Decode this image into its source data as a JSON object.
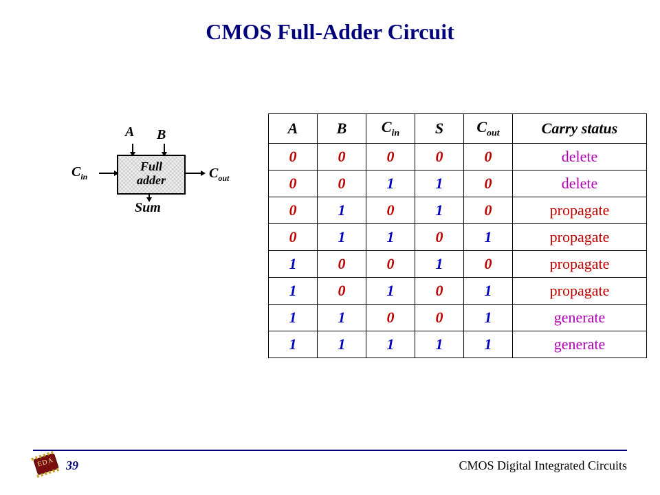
{
  "title": "CMOS Full-Adder Circuit",
  "diagram": {
    "box_label1": "Full",
    "box_label2": "adder",
    "labels": {
      "A": "A",
      "B": "B",
      "Cin": "C",
      "Cin_sub": "in",
      "Cout": "C",
      "Cout_sub": "out",
      "Sum": "Sum"
    }
  },
  "table": {
    "headers": [
      "A",
      "B",
      "C_in",
      "S",
      "C_out",
      "Carry status"
    ],
    "rows": [
      {
        "v": [
          "0",
          "0",
          "0",
          "0",
          "0"
        ],
        "status": "delete"
      },
      {
        "v": [
          "0",
          "0",
          "1",
          "1",
          "0"
        ],
        "status": "delete"
      },
      {
        "v": [
          "0",
          "1",
          "0",
          "1",
          "0"
        ],
        "status": "propagate"
      },
      {
        "v": [
          "0",
          "1",
          "1",
          "0",
          "1"
        ],
        "status": "propagate"
      },
      {
        "v": [
          "1",
          "0",
          "0",
          "1",
          "0"
        ],
        "status": "propagate"
      },
      {
        "v": [
          "1",
          "0",
          "1",
          "0",
          "1"
        ],
        "status": "propagate"
      },
      {
        "v": [
          "1",
          "1",
          "0",
          "0",
          "1"
        ],
        "status": "generate"
      },
      {
        "v": [
          "1",
          "1",
          "1",
          "1",
          "1"
        ],
        "status": "generate"
      }
    ]
  },
  "footer": {
    "page_number": "39",
    "course": "CMOS Digital Integrated Circuits",
    "logo_text": "EDA"
  },
  "chart_data": {
    "type": "table",
    "title": "Full-adder truth table with carry status",
    "columns": [
      "A",
      "B",
      "Cin",
      "S",
      "Cout",
      "Carry status"
    ],
    "rows": [
      [
        0,
        0,
        0,
        0,
        0,
        "delete"
      ],
      [
        0,
        0,
        1,
        1,
        0,
        "delete"
      ],
      [
        0,
        1,
        0,
        1,
        0,
        "propagate"
      ],
      [
        0,
        1,
        1,
        0,
        1,
        "propagate"
      ],
      [
        1,
        0,
        0,
        1,
        0,
        "propagate"
      ],
      [
        1,
        0,
        1,
        0,
        1,
        "propagate"
      ],
      [
        1,
        1,
        0,
        0,
        1,
        "generate"
      ],
      [
        1,
        1,
        1,
        1,
        1,
        "generate"
      ]
    ]
  }
}
